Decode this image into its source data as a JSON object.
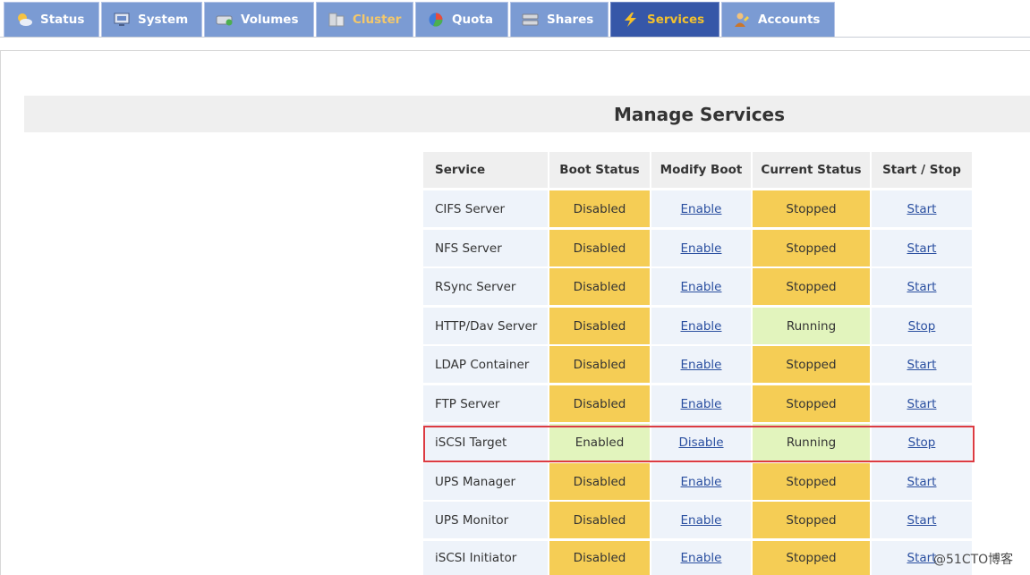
{
  "nav": {
    "tabs": [
      {
        "label": "Status",
        "icon": "status-icon",
        "state": "normal"
      },
      {
        "label": "System",
        "icon": "system-icon",
        "state": "normal"
      },
      {
        "label": "Volumes",
        "icon": "volumes-icon",
        "state": "normal"
      },
      {
        "label": "Cluster",
        "icon": "cluster-icon",
        "state": "dim"
      },
      {
        "label": "Quota",
        "icon": "quota-icon",
        "state": "normal"
      },
      {
        "label": "Shares",
        "icon": "shares-icon",
        "state": "normal"
      },
      {
        "label": "Services",
        "icon": "lightning-icon",
        "state": "active"
      },
      {
        "label": "Accounts",
        "icon": "accounts-icon",
        "state": "normal"
      }
    ]
  },
  "page": {
    "title": "Manage Services"
  },
  "table": {
    "headers": [
      "Service",
      "Boot Status",
      "Modify Boot",
      "Current Status",
      "Start / Stop"
    ],
    "rows": [
      {
        "service": "CIFS Server",
        "boot": "Disabled",
        "modify": "Enable",
        "current": "Stopped",
        "action": "Start"
      },
      {
        "service": "NFS Server",
        "boot": "Disabled",
        "modify": "Enable",
        "current": "Stopped",
        "action": "Start"
      },
      {
        "service": "RSync Server",
        "boot": "Disabled",
        "modify": "Enable",
        "current": "Stopped",
        "action": "Start"
      },
      {
        "service": "HTTP/Dav Server",
        "boot": "Disabled",
        "modify": "Enable",
        "current": "Running",
        "action": "Stop"
      },
      {
        "service": "LDAP Container",
        "boot": "Disabled",
        "modify": "Enable",
        "current": "Stopped",
        "action": "Start"
      },
      {
        "service": "FTP Server",
        "boot": "Disabled",
        "modify": "Enable",
        "current": "Stopped",
        "action": "Start"
      },
      {
        "service": "iSCSI Target",
        "boot": "Enabled",
        "modify": "Disable",
        "current": "Running",
        "action": "Stop"
      },
      {
        "service": "UPS Manager",
        "boot": "Disabled",
        "modify": "Enable",
        "current": "Stopped",
        "action": "Start"
      },
      {
        "service": "UPS Monitor",
        "boot": "Disabled",
        "modify": "Enable",
        "current": "Stopped",
        "action": "Start"
      },
      {
        "service": "iSCSI Initiator",
        "boot": "Disabled",
        "modify": "Enable",
        "current": "Stopped",
        "action": "Start"
      }
    ]
  },
  "colors": {
    "tab": "#7b9bd3",
    "tab_active": "#3657a8",
    "status_disabled": "#f5cd55",
    "status_enabled": "#e2f4bd",
    "link": "#2a4fa0",
    "highlight": "#dc3b42"
  },
  "watermark": "@51CTO博客"
}
